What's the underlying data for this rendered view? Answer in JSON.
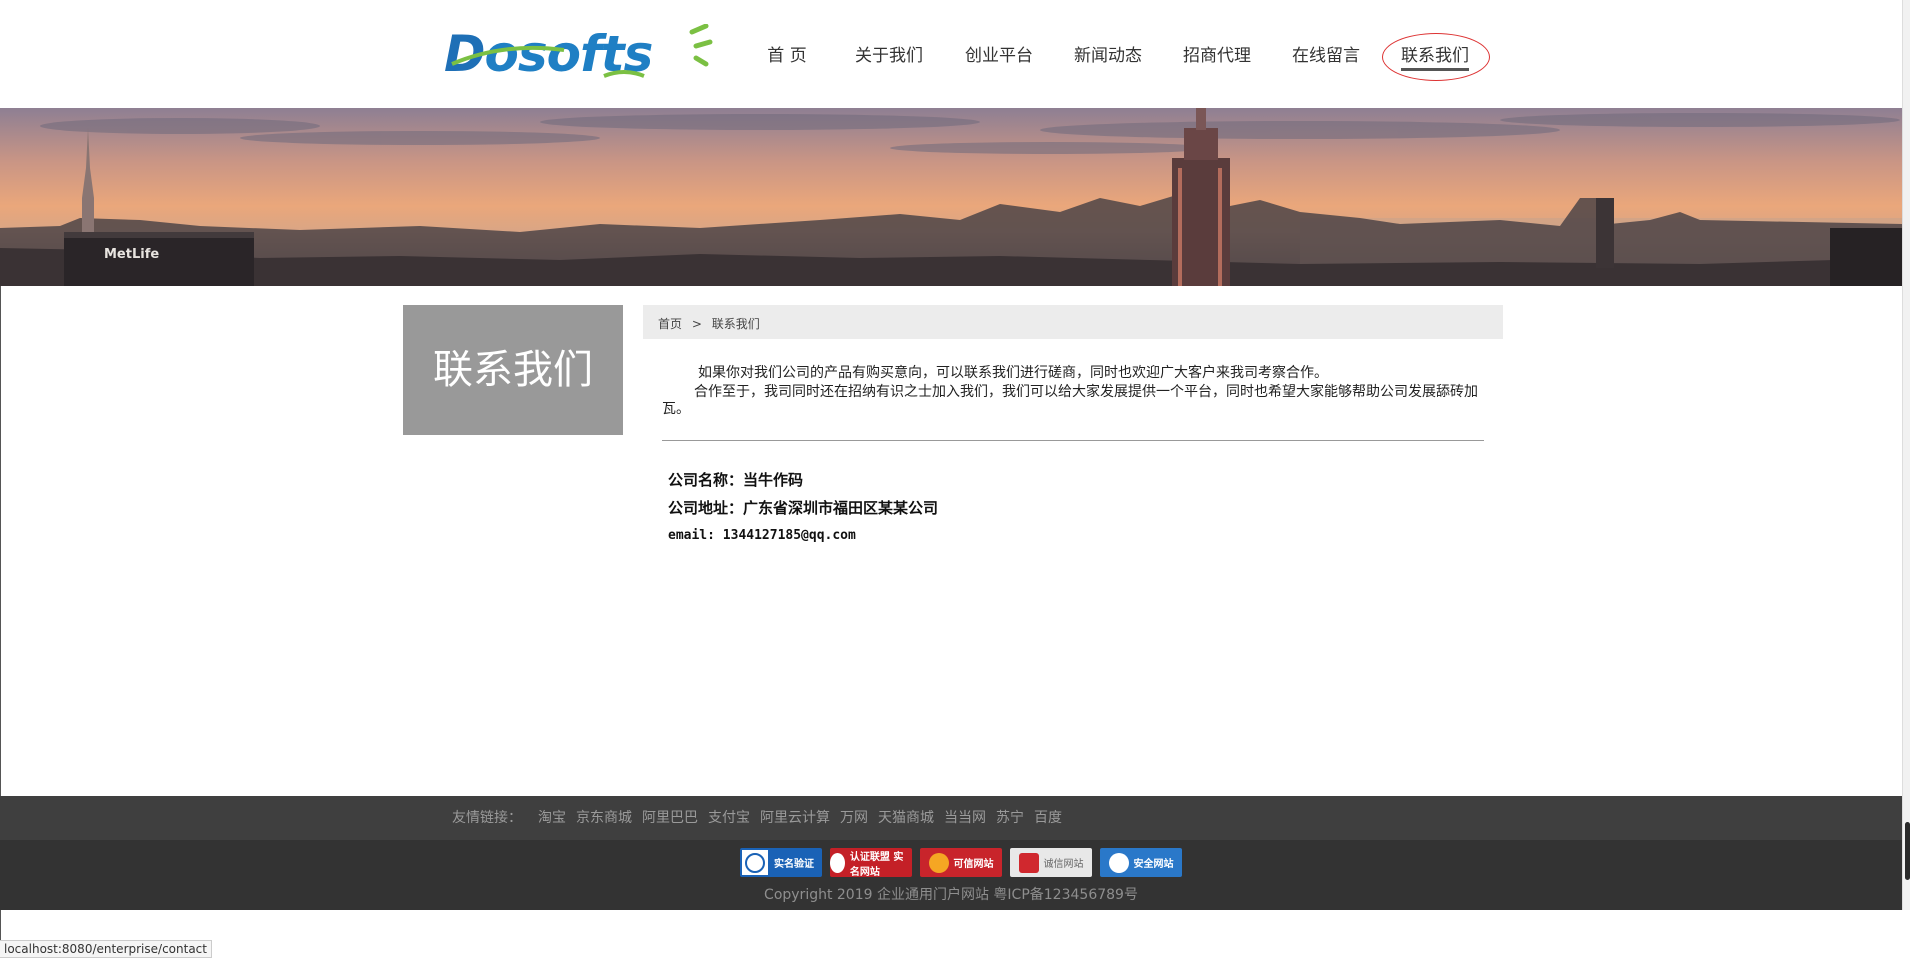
{
  "logo": {
    "text_first": "D",
    "text_rest": "osofts"
  },
  "nav": {
    "items": [
      {
        "label": "首 页"
      },
      {
        "label": "关于我们"
      },
      {
        "label": "创业平台"
      },
      {
        "label": "新闻动态"
      },
      {
        "label": "招商代理"
      },
      {
        "label": "在线留言"
      },
      {
        "label": "联系我们"
      }
    ]
  },
  "banner": {
    "building_sign": "MetLife"
  },
  "sidebar": {
    "title": "联系我们"
  },
  "breadcrumb": {
    "home": "首页",
    "separator": ">",
    "current": "联系我们"
  },
  "intro": {
    "line1": "如果你对我们公司的产品有购买意向，可以联系我们进行磋商，同时也欢迎广大客户来我司考察合作。",
    "line2": "合作至于，我司同时还在招纳有识之士加入我们，我们可以给大家发展提供一个平台，同时也希望大家能够帮助公司发展舔砖加瓦。"
  },
  "contact": {
    "company": "公司名称：当牛作码",
    "address": "公司地址：广东省深圳市福田区某某公司",
    "email": "email: 1344127185@qq.com"
  },
  "friend_links": {
    "title": "友情链接：",
    "links": [
      "淘宝",
      "京东商城",
      "阿里巴巴",
      "支付宝",
      "阿里云计算",
      "万网",
      "天猫商城",
      "当当网",
      "苏宁",
      "百度"
    ]
  },
  "badges": {
    "b1": "实名验证",
    "b2": "认证联盟 实名网站",
    "b3": "可信网站",
    "b4": "诚信网站",
    "b5": "安全网站"
  },
  "copyright": "Copyright 2019 企业通用门户网站 粤ICP备123456789号",
  "status_url": "localhost:8080/enterprise/contact",
  "colors": {
    "nav_active_circle": "#dd3333",
    "side_box": "#999999",
    "footer_dark": "#333333"
  }
}
